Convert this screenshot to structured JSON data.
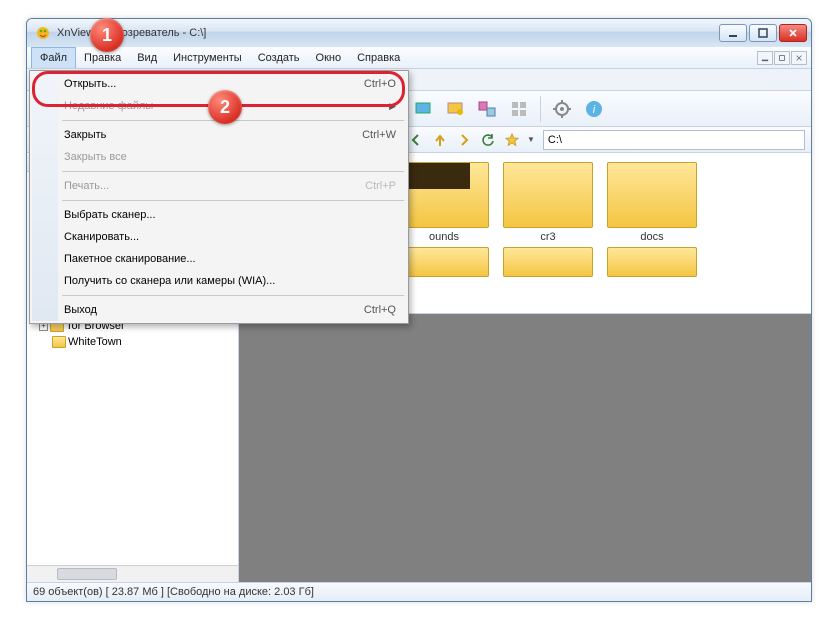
{
  "window": {
    "title": "XnView - [Обозреватель - C:\\]"
  },
  "menubar": {
    "items": [
      "Файл",
      "Правка",
      "Вид",
      "Инструменты",
      "Создать",
      "Окно",
      "Справка"
    ]
  },
  "file_menu": {
    "open": {
      "label": "Открыть...",
      "shortcut": "Ctrl+O"
    },
    "recent": {
      "label": "Недавние файлы"
    },
    "close": {
      "label": "Закрыть",
      "shortcut": "Ctrl+W"
    },
    "close_all": {
      "label": "Закрыть все"
    },
    "print": {
      "label": "Печать...",
      "shortcut": "Ctrl+P"
    },
    "select_scanner": {
      "label": "Выбрать сканер..."
    },
    "scan": {
      "label": "Сканировать..."
    },
    "batch_scan": {
      "label": "Пакетное сканирование..."
    },
    "acquire_wia": {
      "label": "Получить со сканера или камеры (WIA)..."
    },
    "exit": {
      "label": "Выход",
      "shortcut": "Ctrl+Q"
    }
  },
  "navbar": {
    "path": "C:\\"
  },
  "tree": {
    "items": [
      "",
      "",
      "",
      "",
      "",
      "",
      "",
      "Tor Browser",
      "WhiteTown"
    ]
  },
  "thumbs": {
    "row1": [
      {
        "label": ""
      },
      {
        "label": "ounds"
      },
      {
        "label": "cr3"
      },
      {
        "label": "docs"
      }
    ]
  },
  "status": {
    "text": "69 объект(ов) [ 23.87 Мб ] [Свободно на диске: 2.03 Гб]"
  },
  "badges": {
    "one": "1",
    "two": "2"
  }
}
